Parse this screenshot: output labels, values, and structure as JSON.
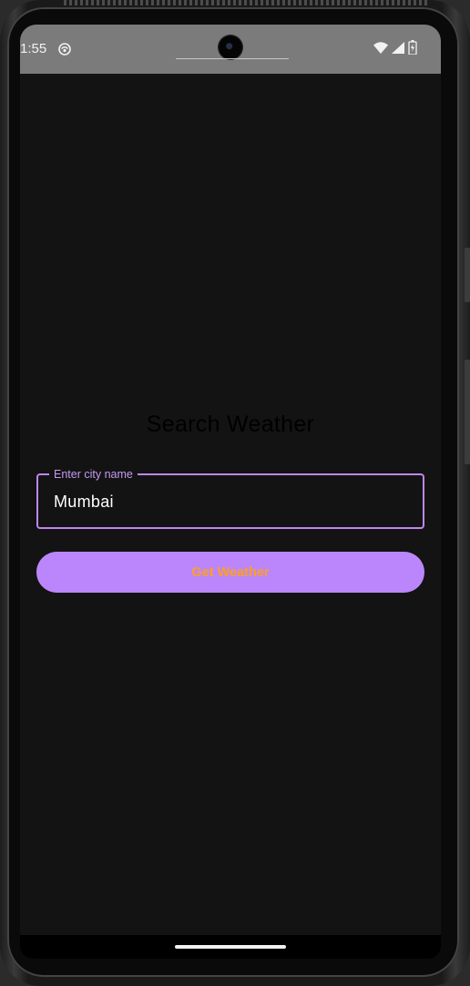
{
  "status_bar": {
    "time": "1:55",
    "notification_icon": "notification-icon",
    "wifi_icon": "wifi-icon",
    "signal_icon": "signal-icon",
    "battery_icon": "battery-icon"
  },
  "screen": {
    "title": "Search Weather",
    "city_field": {
      "label": "Enter city name",
      "value": "Mumbai"
    },
    "get_weather_button": {
      "label": "Get Weather"
    }
  },
  "colors": {
    "accent": "#bb86fc",
    "button_text": "#ff9f1f",
    "background": "#131313",
    "status_bar": "#7b7b7b"
  }
}
